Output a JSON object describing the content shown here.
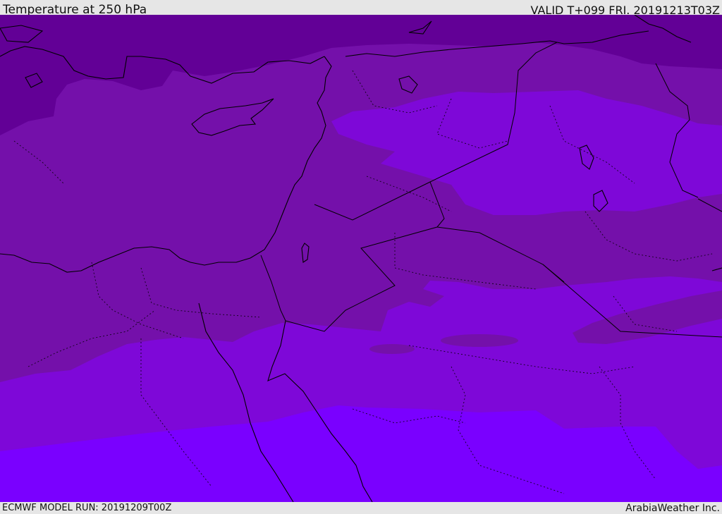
{
  "header": {
    "title": "Temperature at 250 hPa",
    "valid": "VALID T+099 FRI. 20191213T03Z"
  },
  "footer": {
    "model_run": "ECMWF MODEL RUN: 20191209T00Z",
    "credit": "ArabiaWeather Inc."
  },
  "colors": {
    "bands": [
      "#620096",
      "#7410aa",
      "#7e08d8",
      "#7a00ff"
    ],
    "coast": "#000000",
    "border": "#000000",
    "frame": "#e6e6e6"
  }
}
